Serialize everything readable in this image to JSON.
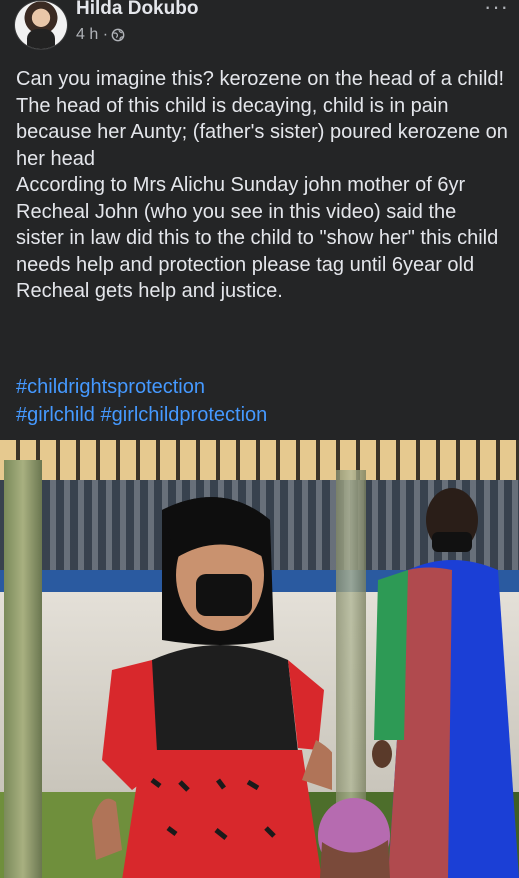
{
  "post": {
    "author": "Hilda Dokubo",
    "time": "4 h ·",
    "privacy_icon": "globe-icon",
    "more_icon": "more-icon",
    "more_label": "···",
    "text": "Can you imagine this? kerozene on the head of a child!\nThe head of this child is decaying, child is in pain because her Aunty; (father's sister) poured kerozene on her head\nAccording to Mrs Alichu Sunday john mother of 6yr Recheal John (who you see in this video) said the sister in law did this to the child to \"show her\" this child needs help and protection please tag until 6year old Recheal gets help and justice.",
    "hashtags": [
      "#childrightsprotection",
      "#girlchild",
      "#girlchildprotection"
    ]
  },
  "colors": {
    "background": "#242526",
    "text": "#e4e6eb",
    "secondary_text": "#b0b3b8",
    "hashtag": "#4599ff"
  }
}
